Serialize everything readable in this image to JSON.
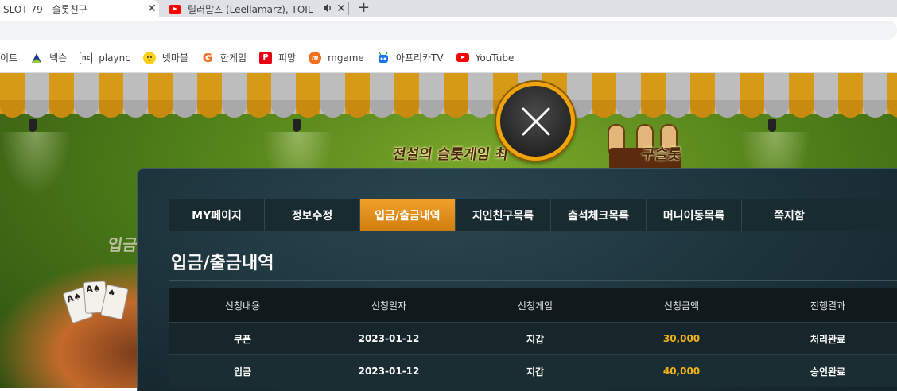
{
  "browser": {
    "active_tab": {
      "title": "SLOT 79 - 슬롯친구"
    },
    "inactive_tab": {
      "title": "릴러말즈 (Leellamarz), TOIL"
    },
    "new_tab_symbol": "+",
    "close_symbol": "✕",
    "audio_symbol": "🔊"
  },
  "bookmarks": [
    {
      "label": "이트",
      "icon": "site-icon"
    },
    {
      "label": "넥슨",
      "icon": "nexon-icon"
    },
    {
      "label": "plaync",
      "icon": "plaync-icon"
    },
    {
      "label": "넷마블",
      "icon": "netmarble-icon"
    },
    {
      "label": "한게임",
      "icon": "hangame-icon"
    },
    {
      "label": "피망",
      "icon": "pmang-icon"
    },
    {
      "label": "mgame",
      "icon": "mgame-icon"
    },
    {
      "label": "아프리카TV",
      "icon": "afreecatv-icon"
    },
    {
      "label": "YouTube",
      "icon": "youtube-icon"
    }
  ],
  "banner": {
    "slogan": "전설의 슬롯게임 최",
    "slogan_tail": "구슬롯",
    "side_text": "입금"
  },
  "modal": {
    "tabs": [
      {
        "label": "MY페이지",
        "active": false
      },
      {
        "label": "정보수정",
        "active": false
      },
      {
        "label": "입금/출금내역",
        "active": true
      },
      {
        "label": "지인친구목록",
        "active": false
      },
      {
        "label": "출석체크목록",
        "active": false
      },
      {
        "label": "머니이동목록",
        "active": false
      },
      {
        "label": "쪽지함",
        "active": false
      }
    ],
    "section_title": "입금/출금내역",
    "table": {
      "headers": [
        "신청내용",
        "신청일자",
        "신청게임",
        "신청금액",
        "진행결과"
      ],
      "rows": [
        {
          "type": "쿠폰",
          "date": "2023-01-12",
          "game": "지갑",
          "amount": "30,000",
          "result": "처리완료"
        },
        {
          "type": "입금",
          "date": "2023-01-12",
          "game": "지갑",
          "amount": "40,000",
          "result": "승인완료"
        }
      ]
    }
  },
  "colors": {
    "accent": "#f0a30a",
    "amount": "#f2b21a",
    "modal_bg": "#1b3038"
  }
}
